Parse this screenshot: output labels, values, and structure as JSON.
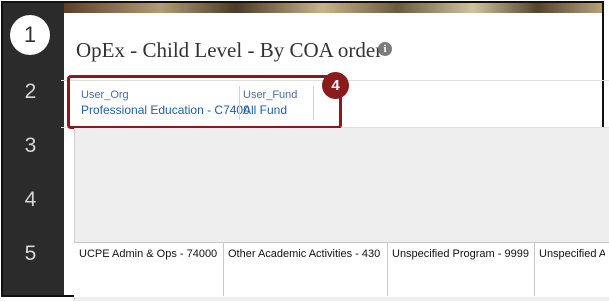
{
  "steps": [
    "1",
    "2",
    "3",
    "4",
    "5"
  ],
  "report": {
    "title": "OpEx - Child Level - By COA order",
    "info_glyph": "i"
  },
  "prompts": {
    "org": {
      "label": "User_Org",
      "value": "Professional Education - C7400"
    },
    "fund": {
      "label": "User_Fund",
      "value": "All Fund"
    }
  },
  "callout": {
    "number": "4"
  },
  "table": {
    "columns": [
      "UCPE Admin & Ops - 74000",
      "Other Academic Activities - 430",
      "Unspecified Program - 9999",
      "Unspecified A"
    ]
  },
  "colors": {
    "callout": "#8b1a1a",
    "link": "#1f5fa8",
    "gutter": "#2b2b2b"
  }
}
